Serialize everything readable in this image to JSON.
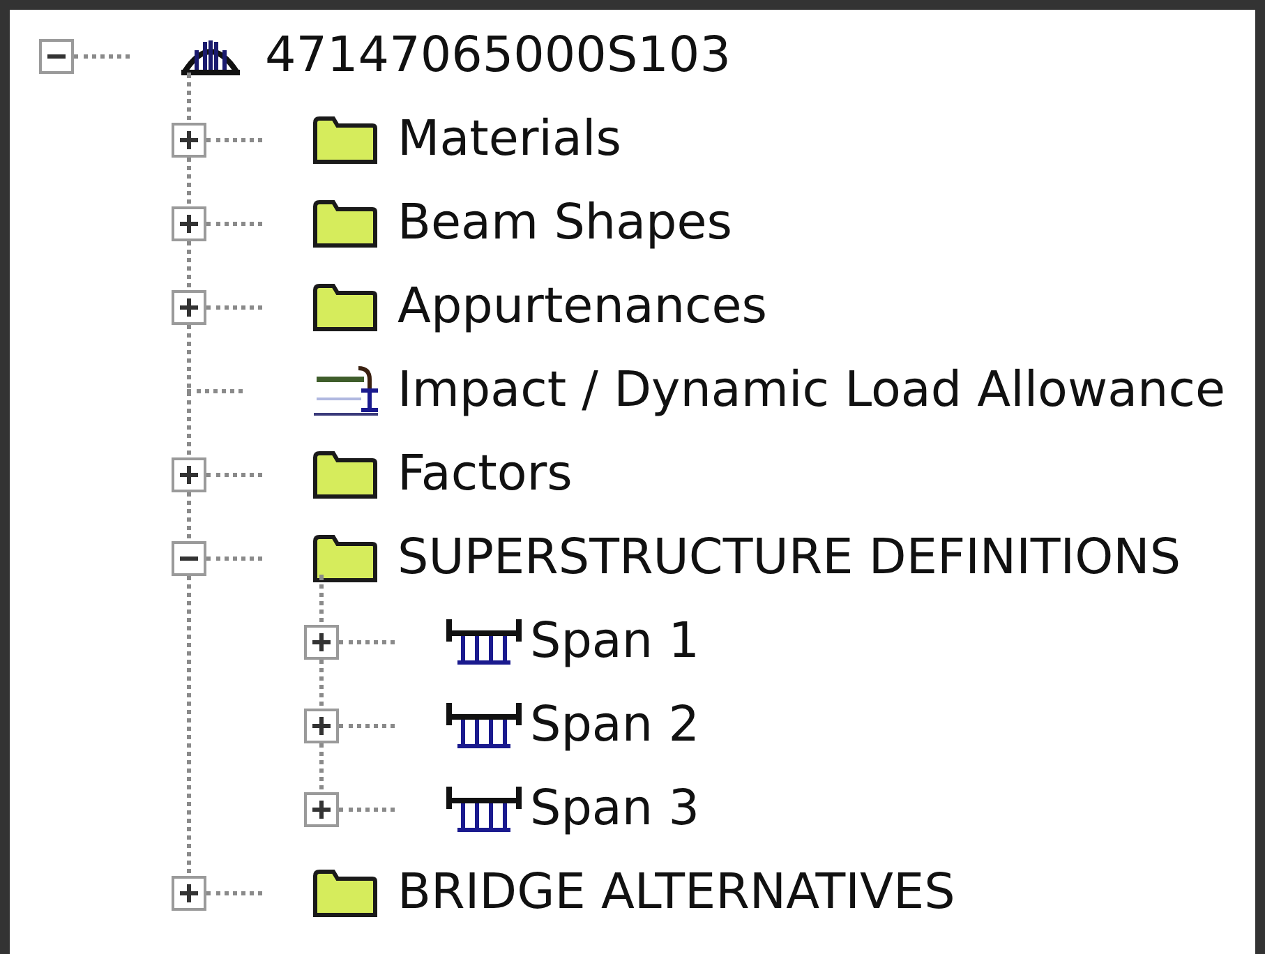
{
  "tree": [
    {
      "label": "47147065000S103",
      "kind": "bridge",
      "expanded": true,
      "children": [
        {
          "label": "Materials",
          "kind": "folder",
          "expanded": false
        },
        {
          "label": "Beam Shapes",
          "kind": "folder",
          "expanded": false
        },
        {
          "label": "Appurtenances",
          "kind": "folder",
          "expanded": false
        },
        {
          "label": "Impact / Dynamic Load Allowance",
          "kind": "impact"
        },
        {
          "label": "Factors",
          "kind": "folder",
          "expanded": false
        },
        {
          "label": "SUPERSTRUCTURE DEFINITIONS",
          "kind": "folder",
          "expanded": true,
          "children": [
            {
              "label": "Span 1",
              "kind": "span",
              "expanded": false
            },
            {
              "label": "Span 2",
              "kind": "span",
              "expanded": false
            },
            {
              "label": "Span 3",
              "kind": "span",
              "expanded": false
            }
          ]
        },
        {
          "label": "BRIDGE ALTERNATIVES",
          "kind": "folder",
          "expanded": false
        }
      ]
    }
  ]
}
